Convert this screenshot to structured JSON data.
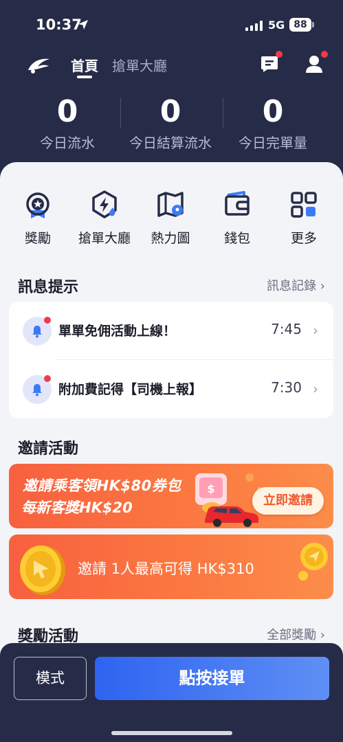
{
  "status_bar": {
    "time": "10:37",
    "network": "5G",
    "battery": "88"
  },
  "header": {
    "tabs": [
      {
        "label": "首頁"
      },
      {
        "label": "搶單大廳"
      }
    ]
  },
  "stats": [
    {
      "value": "0",
      "label": "今日流水"
    },
    {
      "value": "0",
      "label": "今日結算流水"
    },
    {
      "value": "0",
      "label": "今日完單量"
    }
  ],
  "menu": [
    {
      "label": "獎勵",
      "icon": "medal-icon"
    },
    {
      "label": "搶單大廳",
      "icon": "lightning-shield-icon"
    },
    {
      "label": "熱力圖",
      "icon": "map-icon"
    },
    {
      "label": "錢包",
      "icon": "wallet-icon"
    },
    {
      "label": "更多",
      "icon": "grid-icon"
    }
  ],
  "messages_section": {
    "title": "訊息提示",
    "link": "訊息記錄 ›",
    "items": [
      {
        "text": "單單免佣活動上線！",
        "time": "7:45"
      },
      {
        "text": "附加費記得【司機上報】",
        "time": "7:30"
      }
    ]
  },
  "invite_section": {
    "title": "邀請活動",
    "banner1": {
      "line1": "邀請乘客領HK$80券包",
      "line2": "每新客獎HK$20",
      "button": "立即邀請"
    },
    "banner2": {
      "text": "邀請 1人最高可得 HK$310"
    }
  },
  "rewards_section": {
    "title": "獎勵活動",
    "link": "全部獎勵 ›"
  },
  "bottom_bar": {
    "mode_label": "模式",
    "accept_label": "點按接單"
  },
  "colors": {
    "header_bg": "#262b48",
    "accent_blue": "#2e63f0",
    "banner_orange": "#f8603f",
    "badge_red": "#f13a4b"
  }
}
